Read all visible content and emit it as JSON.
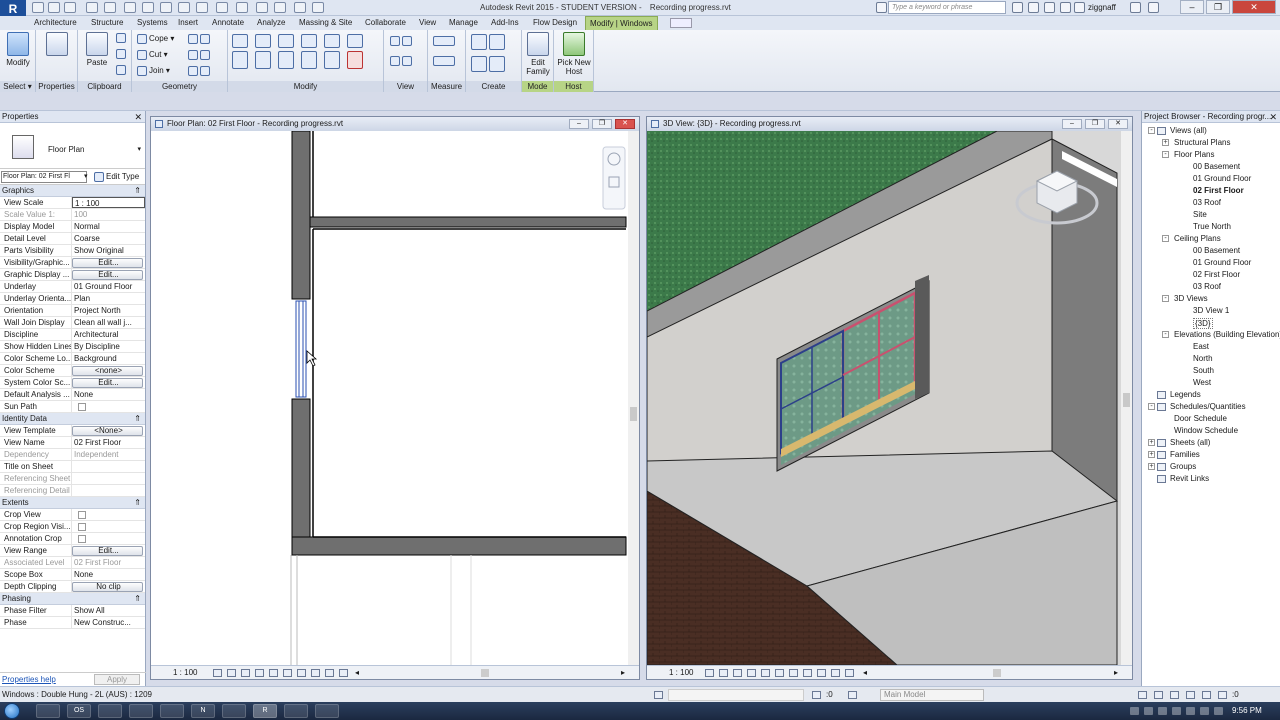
{
  "app": {
    "title": "Autodesk Revit 2015 - STUDENT VERSION -",
    "file_title": "Recording progress.rvt",
    "search_placeholder": "Type a keyword or phrase",
    "user": "ziggnaff",
    "logo": "R"
  },
  "tabs": [
    "Architecture",
    "Structure",
    "Systems",
    "Insert",
    "Annotate",
    "Analyze",
    "Massing & Site",
    "Collaborate",
    "View",
    "Manage",
    "Add-Ins",
    "Flow Design",
    "Modify | Windows"
  ],
  "ribbon": {
    "select": {
      "modify_label": "Modify",
      "group": "Select"
    },
    "properties": {
      "group": "Properties"
    },
    "clipboard": {
      "paste_label": "Paste",
      "group": "Clipboard"
    },
    "geometry": {
      "cope": "Cope",
      "cut": "Cut",
      "join": "Join",
      "group": "Geometry"
    },
    "modify": {
      "group": "Modify"
    },
    "view": {
      "group": "View"
    },
    "measure": {
      "group": "Measure"
    },
    "create": {
      "group": "Create"
    },
    "mode": {
      "edit_family": "Edit Family",
      "group": "Mode"
    },
    "host": {
      "pick_new_host": "Pick New Host",
      "group": "Host"
    }
  },
  "properties": {
    "title": "Properties",
    "type_name": "Floor Plan",
    "view_selector": "Floor Plan: 02 First Fl",
    "edit_type": "Edit Type",
    "sections": [
      {
        "name": "Graphics",
        "rows": [
          {
            "k": "View Scale",
            "v": "1 : 100",
            "style": "boxed"
          },
          {
            "k": "Scale Value    1:",
            "v": "100",
            "style": "grey"
          },
          {
            "k": "Display Model",
            "v": "Normal"
          },
          {
            "k": "Detail Level",
            "v": "Coarse"
          },
          {
            "k": "Parts Visibility",
            "v": "Show Original"
          },
          {
            "k": "Visibility/Graphic...",
            "v": "Edit...",
            "style": "btn"
          },
          {
            "k": "Graphic Display ...",
            "v": "Edit...",
            "style": "btn"
          },
          {
            "k": "Underlay",
            "v": "01 Ground Floor"
          },
          {
            "k": "Underlay Orienta...",
            "v": "Plan"
          },
          {
            "k": "Orientation",
            "v": "Project North"
          },
          {
            "k": "Wall Join Display",
            "v": "Clean all wall j..."
          },
          {
            "k": "Discipline",
            "v": "Architectural"
          },
          {
            "k": "Show Hidden Lines",
            "v": "By Discipline"
          },
          {
            "k": "Color Scheme Lo...",
            "v": "Background"
          },
          {
            "k": "Color Scheme",
            "v": "<none>",
            "style": "btn"
          },
          {
            "k": "System Color Sc...",
            "v": "Edit...",
            "style": "btn"
          },
          {
            "k": "Default Analysis ...",
            "v": "None"
          },
          {
            "k": "Sun Path",
            "v": "",
            "style": "check"
          }
        ]
      },
      {
        "name": "Identity Data",
        "rows": [
          {
            "k": "View Template",
            "v": "<None>",
            "style": "btn"
          },
          {
            "k": "View Name",
            "v": "02 First Floor"
          },
          {
            "k": "Dependency",
            "v": "Independent",
            "style": "grey"
          },
          {
            "k": "Title on Sheet",
            "v": ""
          },
          {
            "k": "Referencing Sheet",
            "v": "",
            "style": "grey"
          },
          {
            "k": "Referencing Detail",
            "v": "",
            "style": "grey"
          }
        ]
      },
      {
        "name": "Extents",
        "rows": [
          {
            "k": "Crop View",
            "v": "",
            "style": "check"
          },
          {
            "k": "Crop Region Visi...",
            "v": "",
            "style": "check"
          },
          {
            "k": "Annotation Crop",
            "v": "",
            "style": "check"
          },
          {
            "k": "View Range",
            "v": "Edit...",
            "style": "btn"
          },
          {
            "k": "Associated Level",
            "v": "02 First Floor",
            "style": "grey"
          },
          {
            "k": "Scope Box",
            "v": "None"
          },
          {
            "k": "Depth Clipping",
            "v": "No clip",
            "style": "btn"
          }
        ]
      },
      {
        "name": "Phasing",
        "rows": [
          {
            "k": "Phase Filter",
            "v": "Show All"
          },
          {
            "k": "Phase",
            "v": "New Construc..."
          }
        ]
      }
    ],
    "help": "Properties help",
    "apply": "Apply"
  },
  "floorplan": {
    "title": "Floor Plan: 02 First Floor - Recording progress.rvt",
    "scale": "1 : 100"
  },
  "view3d": {
    "title": "3D View: {3D} - Recording progress.rvt",
    "scale": "1 : 100"
  },
  "browser": {
    "title": "Project Browser - Recording progr...",
    "nodes": [
      {
        "label": "Views (all)",
        "level": 0,
        "exp": "-",
        "icon": true
      },
      {
        "label": "Structural Plans",
        "level": 1,
        "exp": "+"
      },
      {
        "label": "Floor Plans",
        "level": 1,
        "exp": "-"
      },
      {
        "label": "00 Basement",
        "level": 2
      },
      {
        "label": "01 Ground Floor",
        "level": 2
      },
      {
        "label": "02 First Floor",
        "level": 2,
        "bold": true
      },
      {
        "label": "03 Roof",
        "level": 2
      },
      {
        "label": "Site",
        "level": 2
      },
      {
        "label": "True North",
        "level": 2
      },
      {
        "label": "Ceiling Plans",
        "level": 1,
        "exp": "-"
      },
      {
        "label": "00 Basement",
        "level": 2
      },
      {
        "label": "01 Ground Floor",
        "level": 2
      },
      {
        "label": "02 First Floor",
        "level": 2
      },
      {
        "label": "03 Roof",
        "level": 2
      },
      {
        "label": "3D Views",
        "level": 1,
        "exp": "-"
      },
      {
        "label": "3D View 1",
        "level": 2
      },
      {
        "label": "{3D}",
        "level": 2,
        "boxed": true
      },
      {
        "label": "Elevations (Building Elevation)",
        "level": 1,
        "exp": "-"
      },
      {
        "label": "East",
        "level": 2
      },
      {
        "label": "North",
        "level": 2
      },
      {
        "label": "South",
        "level": 2
      },
      {
        "label": "West",
        "level": 2
      },
      {
        "label": "Legends",
        "level": 0,
        "icon": true
      },
      {
        "label": "Schedules/Quantities",
        "level": 0,
        "exp": "-",
        "icon": true
      },
      {
        "label": "Door Schedule",
        "level": 1
      },
      {
        "label": "Window Schedule",
        "level": 1
      },
      {
        "label": "Sheets (all)",
        "level": 0,
        "exp": "+",
        "icon": true
      },
      {
        "label": "Families",
        "level": 0,
        "exp": "+",
        "icon": true
      },
      {
        "label": "Groups",
        "level": 0,
        "exp": "+",
        "icon": true
      },
      {
        "label": "Revit Links",
        "level": 0,
        "icon": true
      }
    ]
  },
  "status": {
    "text": "Windows : Double Hung - 2L (AUS) : 1209",
    "zero": ":0",
    "main_model": "Main Model"
  },
  "taskbar": {
    "clock": "9:56 PM",
    "apps": [
      "",
      "OS",
      "",
      "",
      "",
      "N",
      "",
      "R",
      "",
      ""
    ]
  },
  "colors": {
    "accent_green": "#b7d486",
    "grass": "#3c7a4a",
    "wall_cut": "#6f6f6f"
  }
}
